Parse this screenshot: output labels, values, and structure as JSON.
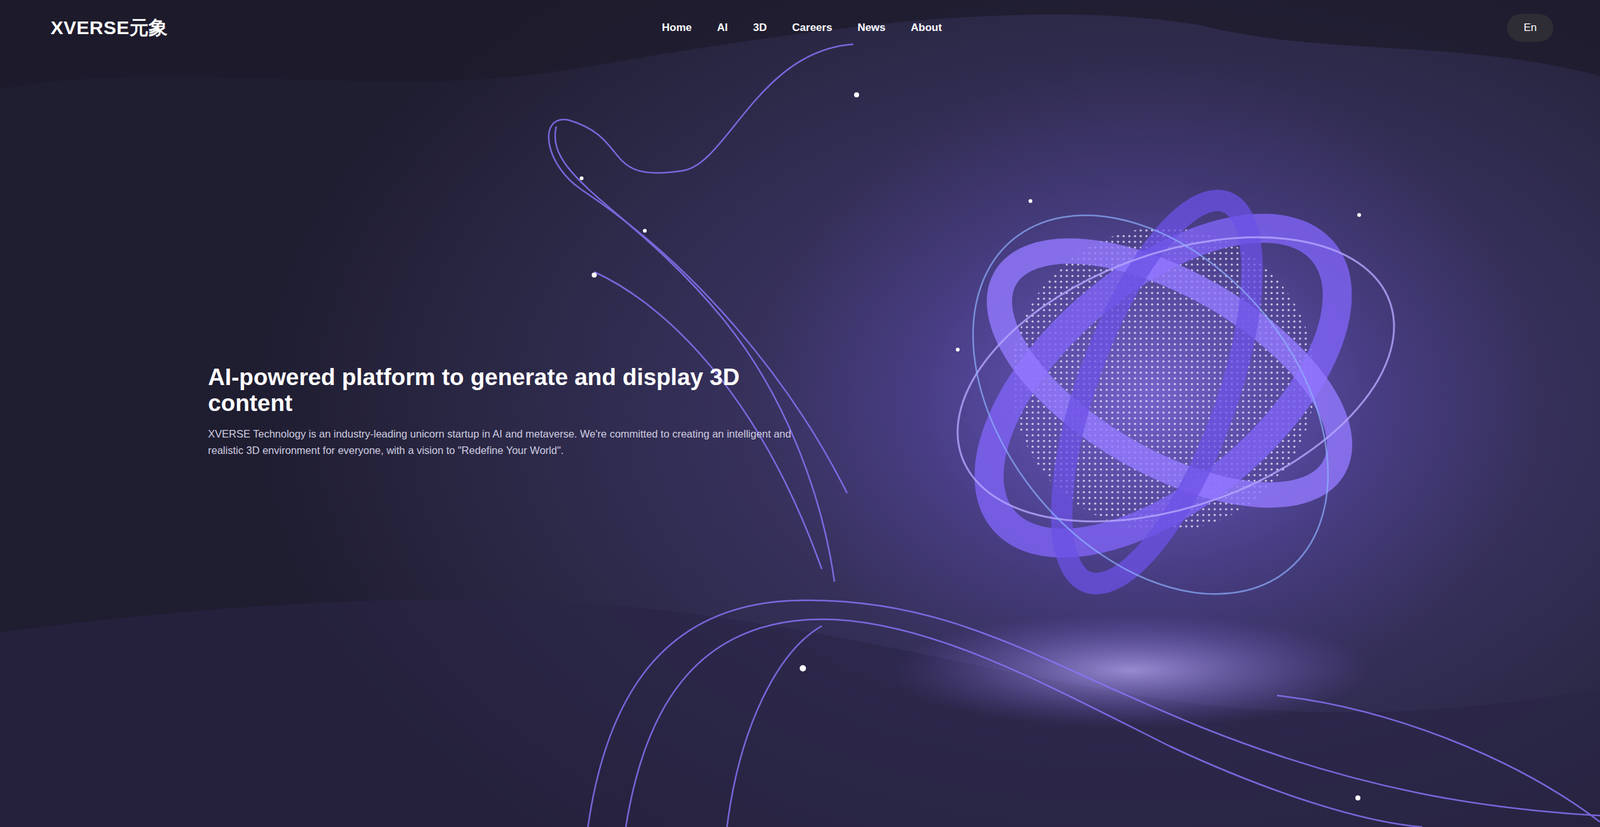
{
  "logo": "XVERSE元象",
  "nav": [
    {
      "label": "Home"
    },
    {
      "label": "AI"
    },
    {
      "label": "3D"
    },
    {
      "label": "Careers"
    },
    {
      "label": "News"
    },
    {
      "label": "About"
    }
  ],
  "language": "En",
  "hero": {
    "title": "AI-powered platform to generate and display 3D content",
    "description": "XVERSE Technology is an industry-leading unicorn startup in AI and metaverse. We're committed to creating an intelligent and realistic 3D environment for everyone, with a vision to \"Redefine Your World\"."
  }
}
